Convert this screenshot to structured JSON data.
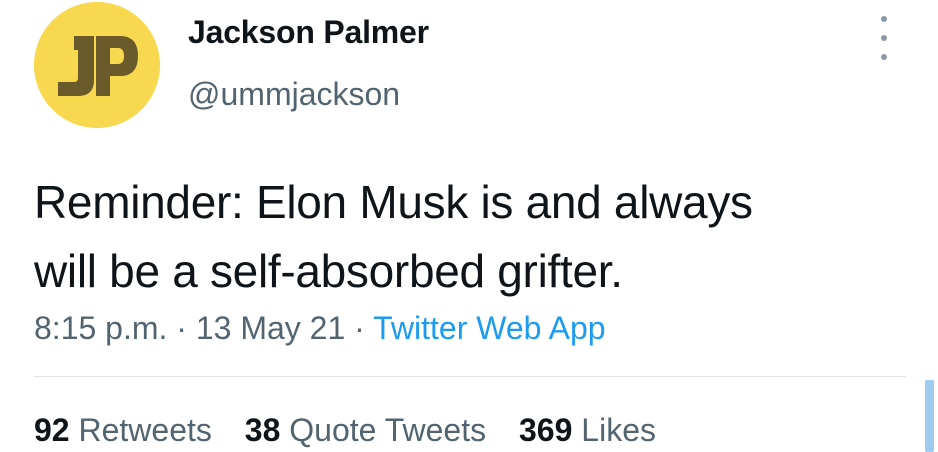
{
  "user": {
    "display_name": "Jackson Palmer",
    "handle": "@ummjackson",
    "avatar_letters": "JP"
  },
  "tweet": {
    "text_line1": "Reminder: Elon Musk is and always",
    "text_line2": "will be a self-absorbed grifter.",
    "time": "8:15 p.m.",
    "separator": "·",
    "date": "13 May 21",
    "source": "Twitter Web App"
  },
  "stats": {
    "retweets_count": "92",
    "retweets_label": "Retweets",
    "quote_tweets_count": "38",
    "quote_tweets_label": "Quote Tweets",
    "likes_count": "369",
    "likes_label": "Likes"
  },
  "colors": {
    "avatar_bg": "#f7d84f",
    "avatar_letters": "#6b5a2a",
    "link": "#1d9bf0",
    "secondary_text": "#536471"
  },
  "icons": {
    "more": "more-vertical-icon"
  }
}
